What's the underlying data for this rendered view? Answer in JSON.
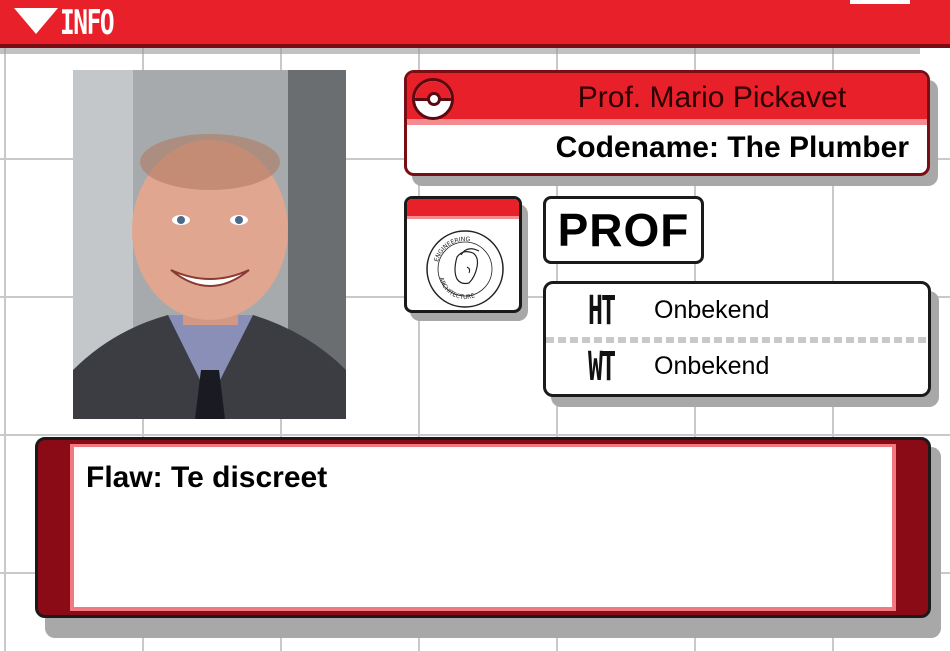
{
  "header": {
    "title": "INFO"
  },
  "profile": {
    "name": "Prof. Mario Pickavet",
    "codename": "Codename: The Plumber",
    "type": "PROF",
    "logo_text_top": "ENGINEERING",
    "logo_text_bottom": "ARCHITECTURE"
  },
  "stats": [
    {
      "key": "HT",
      "value": "Onbekend"
    },
    {
      "key": "WT",
      "value": "Onbekend"
    }
  ],
  "flaw": {
    "text": "Flaw: Te discreet"
  },
  "colors": {
    "accent": "#e8202a",
    "dark_red": "#7a0d14",
    "pink_trim": "#f38b8f",
    "grid": "#c9c9c9"
  },
  "icons": [
    "triangle-down-icon",
    "pokeball-icon",
    "faculty-logo-icon"
  ]
}
